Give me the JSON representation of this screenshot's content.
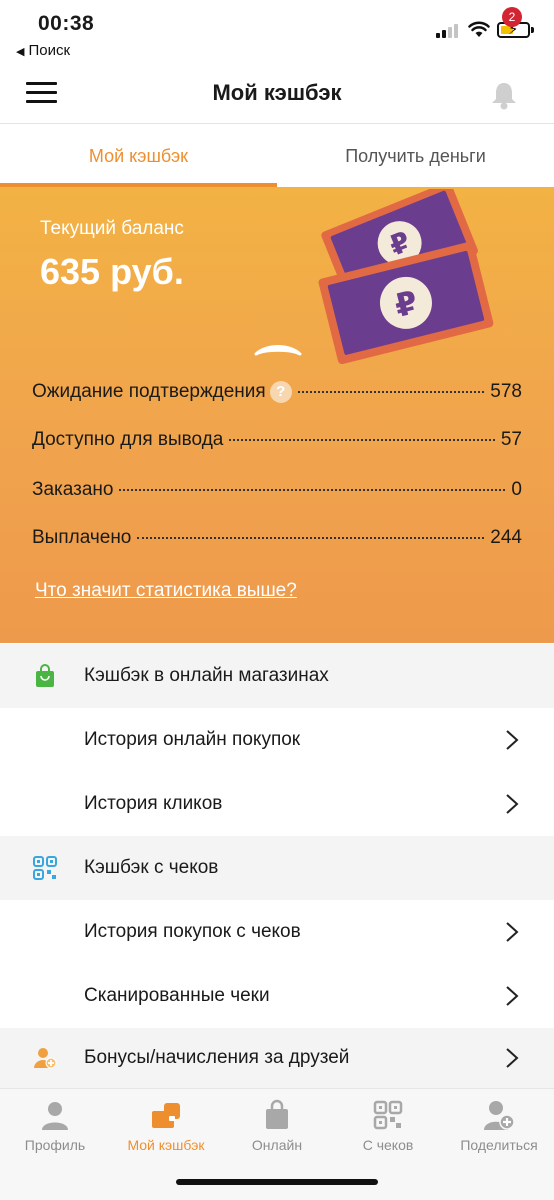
{
  "status_bar": {
    "time": "00:38",
    "back_app": "Поиск"
  },
  "nav": {
    "title": "Мой кэшбэк",
    "notification_count": "2"
  },
  "tabs": [
    {
      "label": "Мой кэшбэк",
      "active": true
    },
    {
      "label": "Получить деньги",
      "active": false
    }
  ],
  "balance": {
    "label": "Текущий баланс",
    "value": "635 руб."
  },
  "stats": [
    {
      "label": "Ожидание подтверждения",
      "value": "578",
      "has_help": true,
      "help_symbol": "?"
    },
    {
      "label": "Доступно для вывода",
      "value": "57"
    },
    {
      "label": "Заказано",
      "value": "0"
    },
    {
      "label": "Выплачено",
      "value": "244"
    }
  ],
  "stats_link": "Что значит статистика выше?",
  "sections": {
    "online": {
      "title": "Кэшбэк в онлайн магазинах",
      "icon": "shopping-bag-icon",
      "items": [
        "История онлайн покупок",
        "История кликов"
      ]
    },
    "receipts": {
      "title": "Кэшбэк с чеков",
      "icon": "qr-code-icon",
      "items": [
        "История покупок с чеков",
        "Сканированные чеки"
      ]
    },
    "friends": {
      "title": "Бонусы/начисления за друзей",
      "icon": "add-user-icon"
    }
  },
  "tabbar": [
    {
      "label": "Профиль",
      "icon": "person-icon",
      "active": false
    },
    {
      "label": "Мой кэшбэк",
      "icon": "wallet-icon",
      "active": true
    },
    {
      "label": "Онлайн",
      "icon": "bag-icon",
      "active": false
    },
    {
      "label": "С чеков",
      "icon": "qr-icon",
      "active": false
    },
    {
      "label": "Поделиться",
      "icon": "add-person-icon",
      "active": false
    }
  ],
  "colors": {
    "accent": "#ee8f2f",
    "balance_bg_top": "#f2b244",
    "balance_bg_bottom": "#ee9a4c",
    "badge": "#d32433",
    "banknote": "#6a3d8e",
    "banknote_border": "#e16a45",
    "section_bg": "#f4f4f4",
    "tab_inactive": "#8d8d8d"
  }
}
